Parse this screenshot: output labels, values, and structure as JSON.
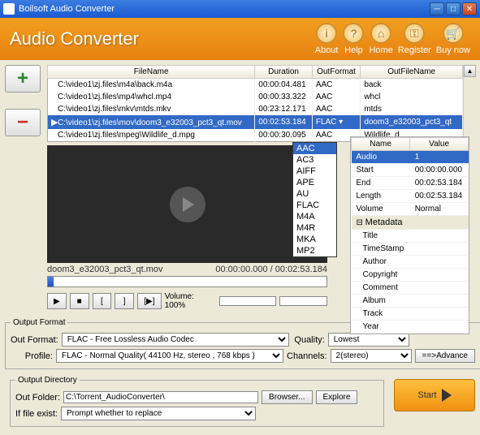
{
  "titlebar": {
    "text": "Boilsoft Audio Converter"
  },
  "header": {
    "title": "Audio Converter",
    "buttons": [
      {
        "label": "About",
        "glyph": "i"
      },
      {
        "label": "Help",
        "glyph": "?"
      },
      {
        "label": "Home",
        "glyph": "⌂"
      },
      {
        "label": "Register",
        "glyph": "⚿"
      },
      {
        "label": "Buy now",
        "glyph": "🛒"
      }
    ]
  },
  "table": {
    "headers": {
      "filename": "FileName",
      "duration": "Duration",
      "outformat": "OutFormat",
      "outfilename": "OutFileName"
    },
    "rows": [
      {
        "fn": "C:\\video1\\zj.files\\m4a\\back.m4a",
        "dur": "00:00:04.481",
        "of": "AAC",
        "ofn": "back"
      },
      {
        "fn": "C:\\video1\\zj.files\\mp4\\whcl.mp4",
        "dur": "00:00:33.322",
        "of": "AAC",
        "ofn": "whcl"
      },
      {
        "fn": "C:\\video1\\zj.files\\mkv\\mtds.mkv",
        "dur": "00:23:12.171",
        "of": "AAC",
        "ofn": "mtds"
      },
      {
        "fn": "C:\\video1\\zj.files\\mov\\doom3_e32003_pct3_qt.mov",
        "dur": "00:02:53.184",
        "of": "FLAC",
        "ofn": "doom3_e32003_pct3_qt"
      },
      {
        "fn": "C:\\video1\\zj.files\\mpeg\\Wildlife_d.mpg",
        "dur": "00:00:30.095",
        "of": "AAC",
        "ofn": "Wildlife_d"
      }
    ]
  },
  "formats": [
    "AAC",
    "AC3",
    "AIFF",
    "APE",
    "AU",
    "FLAC",
    "M4A",
    "M4R",
    "MKA",
    "MP2"
  ],
  "props": {
    "headers": {
      "name": "Name",
      "value": "Value"
    },
    "audio": {
      "label": "Audio",
      "val": "1"
    },
    "start": {
      "label": "Start",
      "val": "00:00:00.000"
    },
    "end": {
      "label": "End",
      "val": "00:02:53.184"
    },
    "length": {
      "label": "Length",
      "val": "00:02:53.184"
    },
    "volume": {
      "label": "Volume",
      "val": "Normal"
    },
    "metadata_label": "Metadata",
    "meta": [
      "Title",
      "TimeStamp",
      "Author",
      "Copyright",
      "Comment",
      "Album",
      "Track",
      "Year"
    ]
  },
  "video": {
    "filename": "doom3_e32003_pct3_qt.mov",
    "time": "00:00:00.000 / 00:02:53.184",
    "volume_label": "Volume: 100%"
  },
  "output_format": {
    "legend": "Output Format",
    "outformat_label": "Out Format:",
    "outformat_val": "FLAC - Free Lossless Audio Codec",
    "profile_label": "Profile:",
    "profile_val": "FLAC - Normal Quality( 44100 Hz, stereo , 768 kbps )",
    "quality_label": "Quality:",
    "quality_val": "Lowest",
    "channels_label": "Channels:",
    "channels_val": "2(stereo)",
    "advance": "==>Advance"
  },
  "output_dir": {
    "legend": "Output Directory",
    "folder_label": "Out Folder:",
    "folder_val": "C:\\Torrent_AudioConverter\\",
    "browser": "Browser...",
    "explore": "Explore",
    "exist_label": "If file exist:",
    "exist_val": "Prompt whether to replace"
  },
  "start": "Start"
}
